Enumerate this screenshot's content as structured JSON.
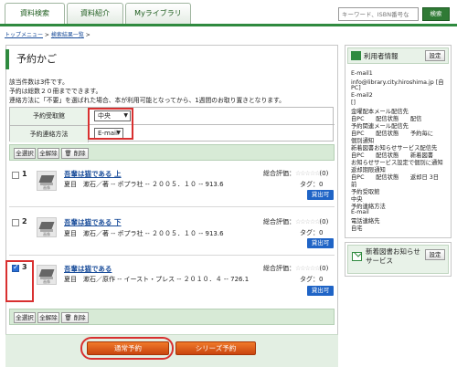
{
  "tabs": [
    {
      "label": "資料検索",
      "active": true
    },
    {
      "label": "資料紹介",
      "active": false
    },
    {
      "label": "Myライブラリ",
      "active": false
    }
  ],
  "search": {
    "placeholder": "キーワード、ISBN番号な",
    "button": "検索"
  },
  "breadcrumb": {
    "home": "トップメニュー",
    "sep": " > ",
    "results": "検索結果一覧",
    "tail": " >"
  },
  "page": {
    "title": "予約かご",
    "notes": [
      "該当件数は3件です。",
      "予約は総数２０冊までできます。",
      "連絡方法に「不要」を選ばれた場合、本が利用可能となってから、1週間のお取り置きとなります。"
    ]
  },
  "form": {
    "pickup_label": "予約受取館",
    "pickup_value": "中央",
    "contact_label": "予約連絡方法",
    "contact_value": "E-mail"
  },
  "toolbar": {
    "select_all": "全選択",
    "clear_all": "全解除",
    "delete": "削除"
  },
  "items": [
    {
      "num": "1",
      "checked": false,
      "title": "吾輩は猫である 上",
      "details": "夏目　漱石／著 -- ポプラ社 -- ２００５．１０ -- 913.6",
      "rating_label": "総合評価：",
      "stars": "☆☆☆☆☆",
      "rating_count": "(0)",
      "tag": "タグ：0",
      "status": "貸出可"
    },
    {
      "num": "2",
      "checked": false,
      "title": "吾輩は猫である 下",
      "details": "夏目　漱石／著 -- ポプラ社 -- ２００５．１０ -- 913.6",
      "rating_label": "総合評価：",
      "stars": "☆☆☆☆☆",
      "rating_count": "(0)",
      "tag": "タグ：0",
      "status": "貸出可"
    },
    {
      "num": "3",
      "checked": true,
      "title": "吾輩は猫である",
      "details": "夏目　漱石／原作 -- イースト・プレス -- ２０１０．４ -- 726.1",
      "rating_label": "総合評価：",
      "stars": "☆☆☆☆☆",
      "rating_count": "(0)",
      "tag": "タグ：0",
      "status": "貸出可"
    }
  ],
  "book_caption": "画像",
  "actions": {
    "reserve": "通常予約",
    "series": "シリーズ予約"
  },
  "sidebar": {
    "user_info": {
      "title": "利用者情報",
      "settings": "設定",
      "lines": [
        "E-mail1",
        "info@library.city.hiroshima.jp [自",
        "PC]",
        "E-mail2",
        "[]",
        "金曜配本メール配信先",
        "自PC　　配信状態　　配信",
        "予約関連メール配信先",
        "自PC　　配信状態　　予約毎に",
        "個別通知",
        "新着図書お知らせサービス配信先",
        "自PC　　配信状態　　新着図書",
        "お知らせサービス設定で個別に通知",
        "返却期限通知",
        "自PC　　配信状態　　返却日 3日",
        "前",
        "予約受取館",
        "中央",
        "予約連絡方法",
        "E-mail",
        "電話連絡先",
        "自宅"
      ]
    },
    "new_books": {
      "title": "新着図書お知らせサービス",
      "settings": "設定"
    }
  },
  "colors": {
    "brand_green": "#2f8a3f",
    "link_blue": "#1a4d9a",
    "orange": "#e0621e",
    "highlight_red": "#d83030",
    "available_blue": "#1f64c6"
  }
}
